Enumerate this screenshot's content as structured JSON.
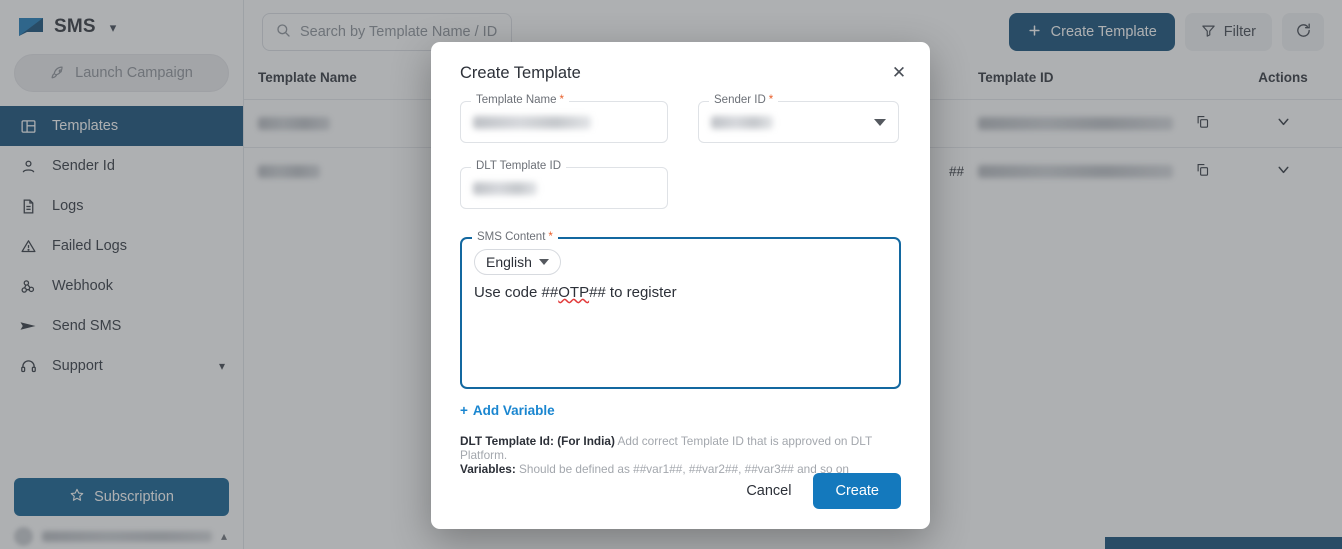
{
  "sidebar": {
    "brand": {
      "title": "SMS",
      "caret_icon": "chevron-down-icon",
      "logo_icon": "sms-logo-icon"
    },
    "launch_campaign": {
      "label": "Launch Campaign",
      "icon": "rocket-icon"
    },
    "items": [
      {
        "label": "Templates",
        "icon": "templates-icon",
        "active": true
      },
      {
        "label": "Sender Id",
        "icon": "user-icon",
        "active": false
      },
      {
        "label": "Logs",
        "icon": "document-icon",
        "active": false
      },
      {
        "label": "Failed Logs",
        "icon": "warning-icon",
        "active": false
      },
      {
        "label": "Webhook",
        "icon": "webhook-icon",
        "active": false
      },
      {
        "label": "Send SMS",
        "icon": "send-icon",
        "active": false
      },
      {
        "label": "Support",
        "icon": "headset-icon",
        "active": false,
        "chevron": "chevron-down-icon"
      }
    ],
    "subscription": {
      "label": "Subscription",
      "icon": "star-icon"
    },
    "user": {
      "name": "",
      "chevron": "chevron-up-icon"
    }
  },
  "toolbar": {
    "search_placeholder": "Search by Template Name / ID",
    "search_value": "",
    "search_icon": "search-icon",
    "create_template": {
      "label": "Create Template",
      "icon": "plus-icon"
    },
    "filter": {
      "label": "Filter",
      "icon": "filter-icon"
    },
    "refresh": {
      "icon": "refresh-icon"
    }
  },
  "table": {
    "columns": [
      "Template Name",
      "Template ID",
      "Actions"
    ],
    "rows": [
      {
        "name": "",
        "content": "",
        "id": "",
        "copy_icon": "copy-icon",
        "expand_icon": "chevron-down-icon"
      },
      {
        "name": "",
        "content": "##",
        "id": "",
        "copy_icon": "copy-icon",
        "expand_icon": "chevron-down-icon"
      }
    ]
  },
  "modal": {
    "title": "Create Template",
    "close_icon": "close-icon",
    "fields": {
      "template_name": {
        "label": "Template Name",
        "required": "*",
        "value": ""
      },
      "sender_id": {
        "label": "Sender ID",
        "required": "*",
        "value": "",
        "caret_icon": "chevron-down-icon"
      },
      "dlt_template_id": {
        "label": "DLT Template ID",
        "required": "",
        "value": ""
      },
      "sms_content": {
        "label": "SMS Content",
        "required": "*",
        "language": "English",
        "language_caret_icon": "chevron-down-icon",
        "text_prefix": "Use code ##",
        "text_variable": "OTP",
        "text_suffix": "## to register"
      }
    },
    "add_variable": {
      "label": "Add Variable",
      "icon": "plus-icon"
    },
    "hints": [
      {
        "bold": "DLT Template Id: (For India)",
        "text": " Add correct Template ID that is approved on DLT Platform."
      },
      {
        "bold": "Variables:",
        "text": " Should be defined as ##var1##, ##var2##, ##var3## and so on"
      }
    ],
    "cancel_label": "Cancel",
    "create_label": "Create"
  },
  "colors": {
    "brand_navy": "#0d4a75",
    "accent_blue": "#1479bd",
    "link_blue": "#1a86d0",
    "focus_blue": "#1368a0",
    "required_orange": "#e8602c"
  }
}
